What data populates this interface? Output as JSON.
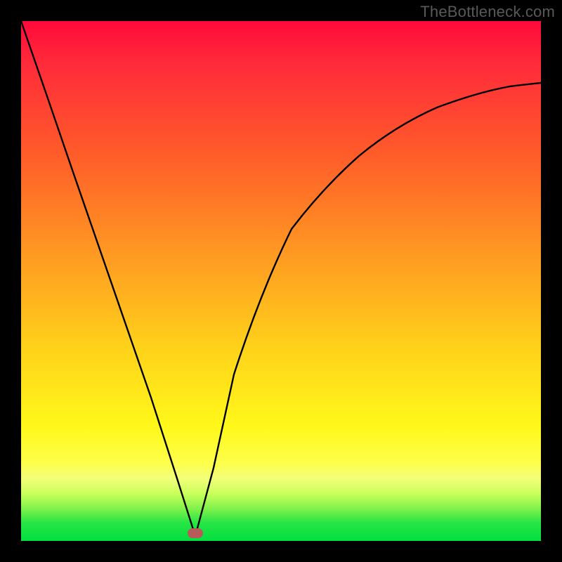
{
  "watermark": "TheBottleneck.com",
  "marker": {
    "x_frac": 0.335,
    "y_frac": 0.985
  },
  "chart_data": {
    "type": "line",
    "title": "",
    "xlabel": "",
    "ylabel": "",
    "xlim": [
      0,
      1
    ],
    "ylim": [
      0,
      1
    ],
    "series": [
      {
        "name": "bottleneck-curve",
        "x": [
          0.0,
          0.05,
          0.1,
          0.15,
          0.2,
          0.25,
          0.3,
          0.335,
          0.37,
          0.41,
          0.46,
          0.52,
          0.58,
          0.65,
          0.72,
          0.8,
          0.88,
          0.94,
          1.0
        ],
        "y": [
          1.0,
          0.855,
          0.71,
          0.565,
          0.42,
          0.275,
          0.12,
          0.01,
          0.14,
          0.32,
          0.475,
          0.6,
          0.68,
          0.74,
          0.782,
          0.816,
          0.84,
          0.855,
          0.868
        ]
      }
    ],
    "background_gradient": {
      "stops": [
        {
          "pos": 0.0,
          "color": "#ff0a3a"
        },
        {
          "pos": 0.25,
          "color": "#ff5a2a"
        },
        {
          "pos": 0.5,
          "color": "#ffba1e"
        },
        {
          "pos": 0.78,
          "color": "#fff81a"
        },
        {
          "pos": 0.92,
          "color": "#aaff55"
        },
        {
          "pos": 1.0,
          "color": "#00e040"
        }
      ]
    },
    "marker": {
      "x": 0.335,
      "y": 0.015,
      "color": "#b75a5a"
    }
  }
}
